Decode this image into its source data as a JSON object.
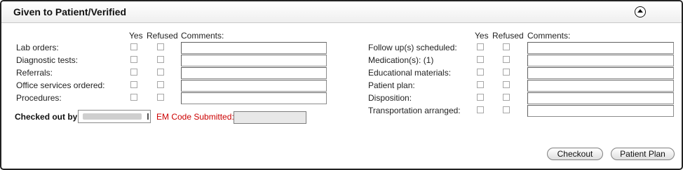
{
  "panel": {
    "title": "Given to Patient/Verified",
    "collapse_icon": "chevron-up-circle-icon"
  },
  "columns": {
    "yes": "Yes",
    "refused": "Refused",
    "comments": "Comments:"
  },
  "left_items": [
    {
      "key": "lab-orders",
      "label": "Lab orders:"
    },
    {
      "key": "diagnostic-tests",
      "label": "Diagnostic tests:"
    },
    {
      "key": "referrals",
      "label": "Referrals:"
    },
    {
      "key": "office-services-ordered",
      "label": "Office services ordered:"
    },
    {
      "key": "procedures",
      "label": "Procedures:"
    }
  ],
  "right_items": [
    {
      "key": "follow-ups-scheduled",
      "label": "Follow up(s) scheduled:"
    },
    {
      "key": "medications",
      "label": "Medication(s): (1)"
    },
    {
      "key": "educational-materials",
      "label": "Educational materials:"
    },
    {
      "key": "patient-plan",
      "label": "Patient plan:"
    },
    {
      "key": "disposition",
      "label": "Disposition:"
    },
    {
      "key": "transportation-arranged",
      "label": "Transportation arranged:"
    }
  ],
  "checked_out_by": {
    "label": "Checked out by:",
    "value": ""
  },
  "em_code": {
    "label": "EM Code Submitted:",
    "value": ""
  },
  "buttons": {
    "checkout": "Checkout",
    "patient_plan": "Patient Plan"
  }
}
